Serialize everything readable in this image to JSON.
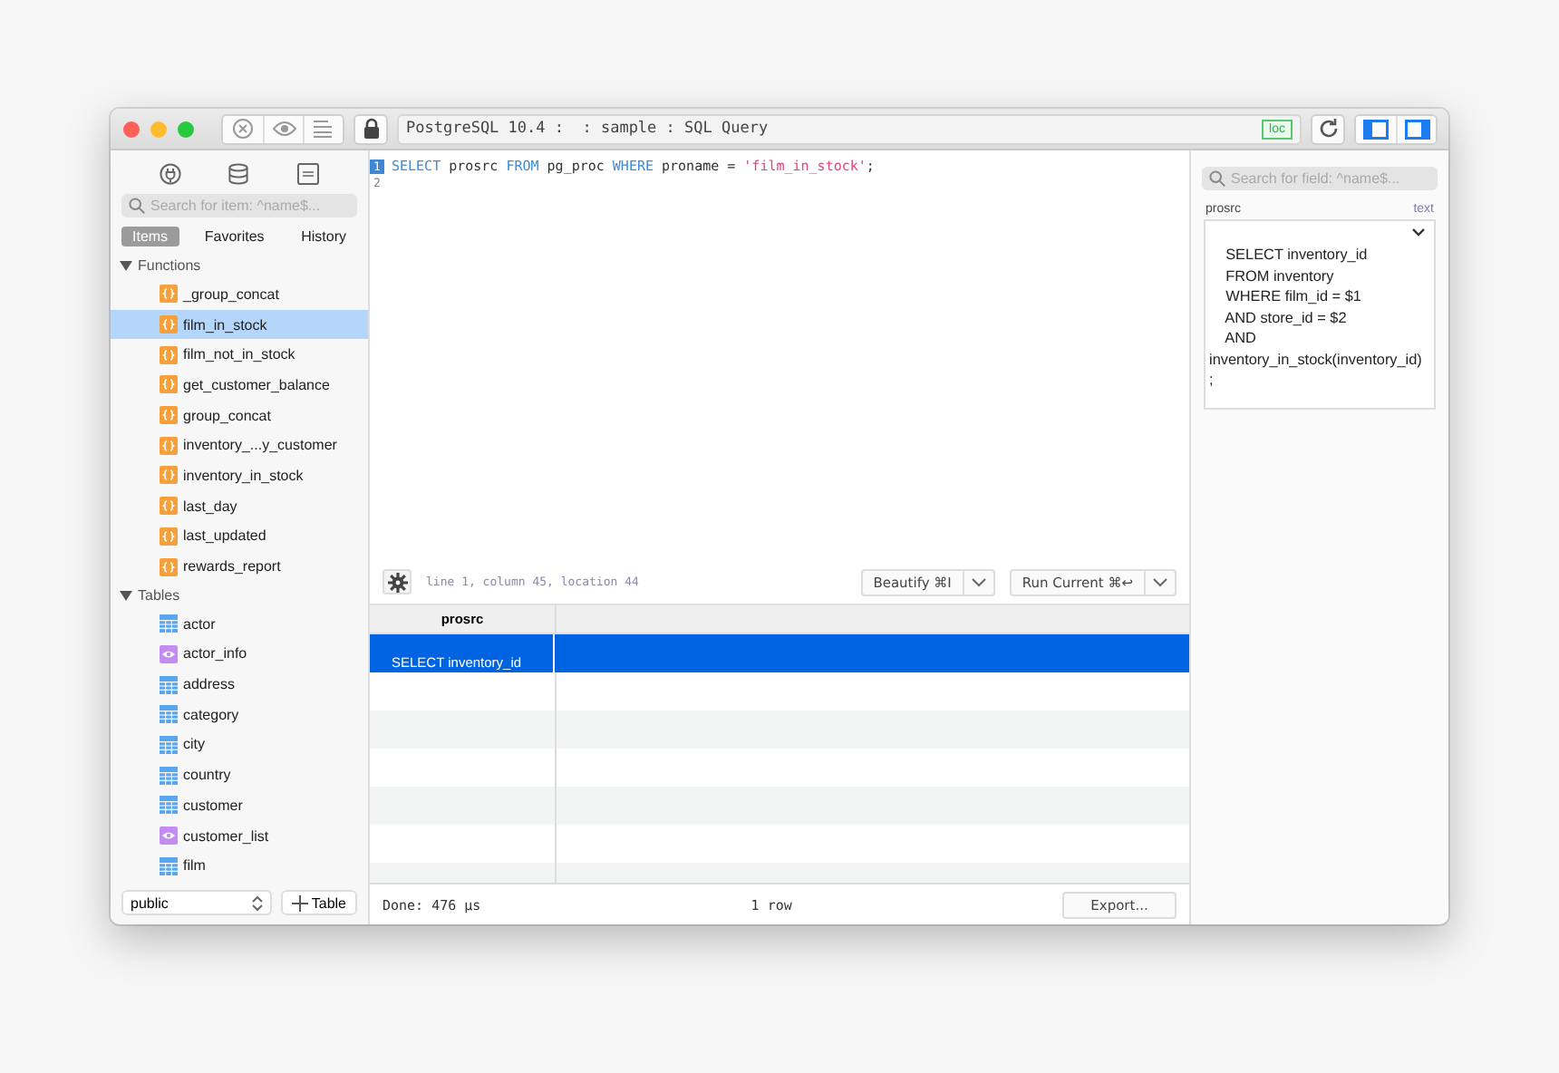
{
  "window": {
    "title": "PostgreSQL 10.4 :  : sample : SQL Query",
    "badge": "loc",
    "left_panel_on": true,
    "right_panel_on": true
  },
  "sidebar": {
    "search": {
      "placeholder": "Search for item: ^name$..."
    },
    "tabs": [
      {
        "label": "Items",
        "selected": true
      },
      {
        "label": "Favorites",
        "selected": false
      },
      {
        "label": "History",
        "selected": false
      }
    ],
    "sections": [
      {
        "label": "Functions",
        "expanded": true,
        "children": [
          {
            "label": "_group_concat",
            "kind": "function",
            "selected": false
          },
          {
            "label": "film_in_stock",
            "kind": "function",
            "selected": true
          },
          {
            "label": "film_not_in_stock",
            "kind": "function",
            "selected": false
          },
          {
            "label": "get_customer_balance",
            "kind": "function",
            "selected": false
          },
          {
            "label": "group_concat",
            "kind": "function",
            "selected": false
          },
          {
            "label": "inventory_...y_customer",
            "kind": "function",
            "selected": false
          },
          {
            "label": "inventory_in_stock",
            "kind": "function",
            "selected": false
          },
          {
            "label": "last_day",
            "kind": "function",
            "selected": false
          },
          {
            "label": "last_updated",
            "kind": "function",
            "selected": false
          },
          {
            "label": "rewards_report",
            "kind": "function",
            "selected": false
          }
        ]
      },
      {
        "label": "Tables",
        "expanded": true,
        "children": [
          {
            "label": "actor",
            "kind": "table",
            "selected": false
          },
          {
            "label": "actor_info",
            "kind": "view",
            "selected": false
          },
          {
            "label": "address",
            "kind": "table",
            "selected": false
          },
          {
            "label": "category",
            "kind": "table",
            "selected": false
          },
          {
            "label": "city",
            "kind": "table",
            "selected": false
          },
          {
            "label": "country",
            "kind": "table",
            "selected": false
          },
          {
            "label": "customer",
            "kind": "table",
            "selected": false
          },
          {
            "label": "customer_list",
            "kind": "view",
            "selected": false
          },
          {
            "label": "film",
            "kind": "table",
            "selected": false
          }
        ]
      }
    ],
    "schema": "public",
    "add_table": "Table"
  },
  "editor": {
    "lines": [
      {
        "number": "1",
        "current": true,
        "tokens": [
          {
            "kind": "keyword",
            "text": "SELECT"
          },
          {
            "kind": "plain",
            "text": " prosrc "
          },
          {
            "kind": "keyword",
            "text": "FROM"
          },
          {
            "kind": "plain",
            "text": " pg_proc "
          },
          {
            "kind": "keyword",
            "text": "WHERE"
          },
          {
            "kind": "plain",
            "text": " proname = "
          },
          {
            "kind": "string",
            "text": "'film_in_stock'"
          },
          {
            "kind": "plain",
            "text": ";"
          }
        ]
      },
      {
        "number": "2",
        "current": false
      }
    ],
    "cursor_info": "line 1, column 45, location 44",
    "beautify": "Beautify ⌘I",
    "run": "Run Current ⌘↩"
  },
  "results": {
    "columns": [
      "prosrc"
    ],
    "rows": [
      {
        "cells": [
          "SELECT inventory_id"
        ],
        "selected": true
      }
    ],
    "status": "Done: 476 µs",
    "row_count": "1 row",
    "export": "Export..."
  },
  "inspector": {
    "search": {
      "placeholder": "Search for field: ^name$..."
    },
    "field": "prosrc",
    "type": "text",
    "value_lines": [
      "    SELECT inventory_id",
      "    FROM inventory",
      "    WHERE film_id = $1",
      "    AND store_id = $2",
      "    AND",
      "inventory_in_stock(inventory_id)",
      ";"
    ]
  }
}
